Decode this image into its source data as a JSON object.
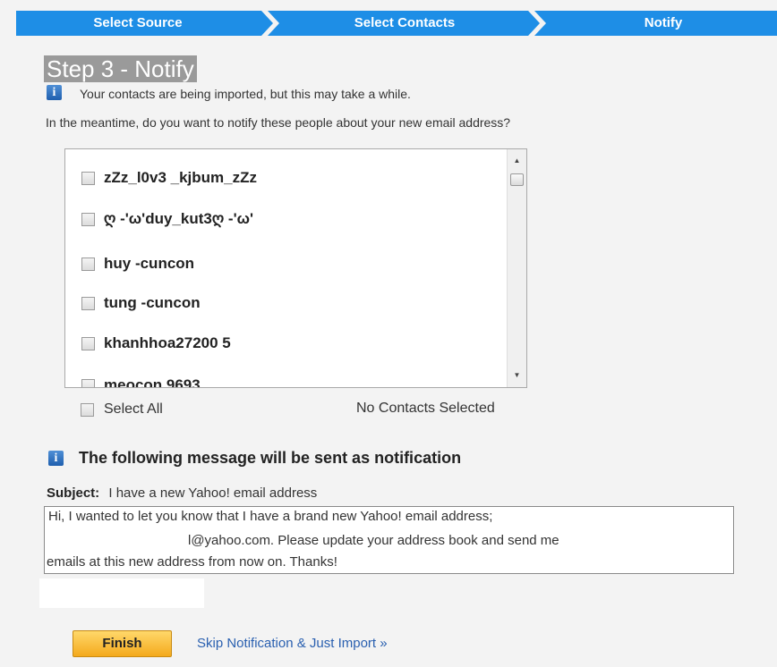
{
  "wizard": {
    "steps": [
      "Select Source",
      "Select Contacts",
      "Notify"
    ],
    "color": "#1e8ee6"
  },
  "step_title": "Step 3 - Notify",
  "info_text": "Your contacts are being imported, but this may take a while.",
  "question_text": "In the meantime, do you want to notify these people about your new email address?",
  "contacts": [
    "zZz_l0v3 _kjbum_zZz",
    "ღ -'ω'duy_kut3ღ -'ω'",
    "huy -cuncon",
    "tung -cuncon",
    "khanhhoa27200 5",
    "meocon 9693"
  ],
  "select_all_label": "Select All",
  "selection_status": "No Contacts Selected",
  "notification": {
    "title": "The following message will be sent as notification",
    "subject_label": "Subject:",
    "subject_value": "I have a new Yahoo! email address",
    "message_lines": [
      "Hi, I wanted to let you know that I have a brand new Yahoo! email address;",
      "l@yahoo.com. Please update your address book and send me",
      "emails at this new address from now on. Thanks!"
    ]
  },
  "actions": {
    "finish_label": "Finish",
    "skip_label": "Skip Notification & Just Import »"
  }
}
